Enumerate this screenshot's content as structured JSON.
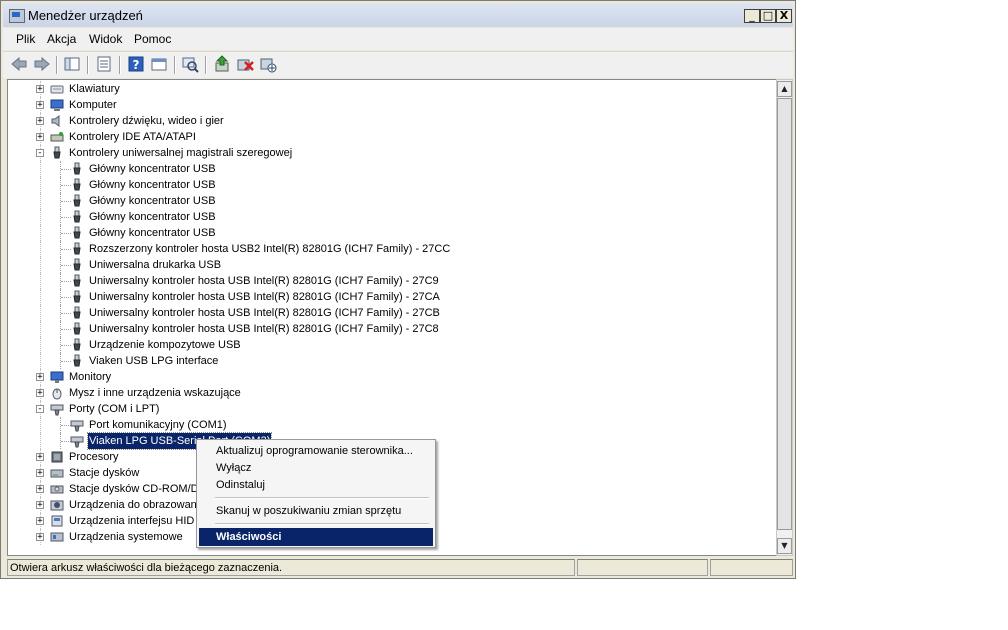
{
  "window": {
    "title": "Menedżer urządzeń",
    "minimize_label": "_",
    "maximize_label": "□",
    "close_label": "X"
  },
  "menu": [
    "Plik",
    "Akcja",
    "Widok",
    "Pomoc"
  ],
  "toolbar": [
    "back-icon",
    "forward-icon",
    "show-hide-tree-icon",
    "properties-icon",
    "help-icon",
    "view-icon",
    "scan-hardware-icon",
    "update-driver-icon",
    "uninstall-icon",
    "disable-icon"
  ],
  "tree": [
    {
      "label": "Klawiatury",
      "level": 1,
      "expander": "+",
      "icon": "keyboard-icon"
    },
    {
      "label": "Komputer",
      "level": 1,
      "expander": "+",
      "icon": "computer-icon"
    },
    {
      "label": "Kontrolery dźwięku, wideo i gier",
      "level": 1,
      "expander": "+",
      "icon": "speaker-icon"
    },
    {
      "label": "Kontrolery IDE ATA/ATAPI",
      "level": 1,
      "expander": "+",
      "icon": "ide-controller-icon"
    },
    {
      "label": "Kontrolery uniwersalnej magistrali szeregowej",
      "level": 1,
      "expander": "-",
      "icon": "usb-icon"
    },
    {
      "label": "Główny koncentrator USB",
      "level": 2,
      "icon": "usb-icon"
    },
    {
      "label": "Główny koncentrator USB",
      "level": 2,
      "icon": "usb-icon"
    },
    {
      "label": "Główny koncentrator USB",
      "level": 2,
      "icon": "usb-icon"
    },
    {
      "label": "Główny koncentrator USB",
      "level": 2,
      "icon": "usb-icon"
    },
    {
      "label": "Główny koncentrator USB",
      "level": 2,
      "icon": "usb-icon"
    },
    {
      "label": "Rozszerzony kontroler hosta USB2 Intel(R) 82801G (ICH7 Family) - 27CC",
      "level": 2,
      "icon": "usb-icon"
    },
    {
      "label": "Uniwersalna drukarka USB",
      "level": 2,
      "icon": "usb-icon"
    },
    {
      "label": "Uniwersalny kontroler hosta USB Intel(R) 82801G (ICH7 Family) - 27C9",
      "level": 2,
      "icon": "usb-icon"
    },
    {
      "label": "Uniwersalny kontroler hosta USB Intel(R) 82801G (ICH7 Family) - 27CA",
      "level": 2,
      "icon": "usb-icon"
    },
    {
      "label": "Uniwersalny kontroler hosta USB Intel(R) 82801G (ICH7 Family) - 27CB",
      "level": 2,
      "icon": "usb-icon"
    },
    {
      "label": "Uniwersalny kontroler hosta USB Intel(R) 82801G (ICH7 Family) - 27C8",
      "level": 2,
      "icon": "usb-icon"
    },
    {
      "label": "Urządzenie kompozytowe USB",
      "level": 2,
      "icon": "usb-icon"
    },
    {
      "label": "Viaken USB LPG interface",
      "level": 2,
      "icon": "usb-icon"
    },
    {
      "label": "Monitory",
      "level": 1,
      "expander": "+",
      "icon": "monitor-icon"
    },
    {
      "label": "Mysz i inne urządzenia wskazujące",
      "level": 1,
      "expander": "+",
      "icon": "mouse-icon"
    },
    {
      "label": "Porty (COM i LPT)",
      "level": 1,
      "expander": "-",
      "icon": "port-icon"
    },
    {
      "label": "Port komunikacyjny (COM1)",
      "level": 2,
      "icon": "port-icon"
    },
    {
      "label": "Viaken LPG USB-Serial Port (COM3)",
      "level": 2,
      "icon": "port-icon",
      "selected": true
    },
    {
      "label": "Procesory",
      "level": 1,
      "expander": "+",
      "icon": "processor-icon"
    },
    {
      "label": "Stacje dysków",
      "level": 1,
      "expander": "+",
      "icon": "disk-drive-icon"
    },
    {
      "label": "Stacje dysków CD-ROM/DVD",
      "level": 1,
      "expander": "+",
      "icon": "cdrom-icon"
    },
    {
      "label": "Urządzenia do obrazowania",
      "level": 1,
      "expander": "+",
      "icon": "imaging-icon"
    },
    {
      "label": "Urządzenia interfejsu HID",
      "level": 1,
      "expander": "+",
      "icon": "hid-icon"
    },
    {
      "label": "Urządzenia systemowe",
      "level": 1,
      "expander": "+",
      "icon": "system-device-icon"
    }
  ],
  "context_menu": {
    "items": [
      {
        "label": "Aktualizuj oprogramowanie sterownika...",
        "highlighted": false
      },
      {
        "label": "Wyłącz",
        "highlighted": false
      },
      {
        "label": "Odinstaluj",
        "highlighted": false
      },
      {
        "label": "Skanuj w poszukiwaniu zmian sprzętu",
        "highlighted": false
      },
      {
        "label": "Właściwości",
        "highlighted": true
      }
    ]
  },
  "status": {
    "text": "Otwiera arkusz właściwości dla bieżącego zaznaczenia."
  },
  "colors": {
    "selection": "#0a246a",
    "window_bg": "#ece9d8",
    "title_gradient": "#c9d4e6"
  }
}
